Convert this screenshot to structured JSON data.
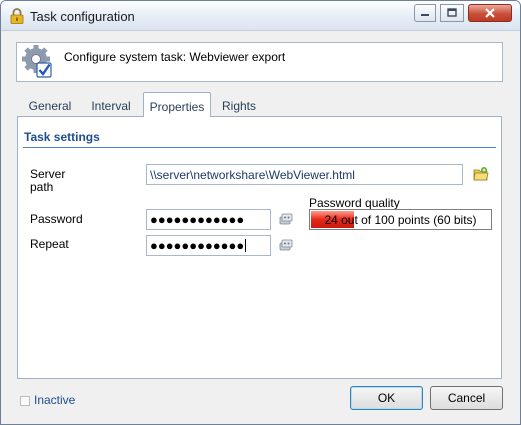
{
  "window": {
    "title": "Task configuration"
  },
  "header": {
    "text": "Configure system task: Webviewer export"
  },
  "tabs": [
    {
      "label": "General"
    },
    {
      "label": "Interval"
    },
    {
      "label": "Properties",
      "active": true
    },
    {
      "label": "Rights"
    }
  ],
  "section": {
    "title": "Task settings"
  },
  "form": {
    "server_path_label_line1": "Server",
    "server_path_label_line2": "path",
    "server_path_value": "\\\\server\\networkshare\\WebViewer.html",
    "password_label": "Password",
    "password_value": "●●●●●●●●●●●●",
    "repeat_label": "Repeat",
    "repeat_value": "●●●●●●●●●●●●",
    "password_quality_label": "Password quality",
    "password_quality_text": "24 out of 100 points (60 bits)",
    "password_quality_points": 24,
    "password_quality_max": 100
  },
  "footer": {
    "inactive_label": "Inactive",
    "inactive_checked": false,
    "ok_label": "OK",
    "cancel_label": "Cancel"
  },
  "icons": {
    "lock": "lock-icon",
    "gear": "gear-checkmark-icon",
    "browse": "folder-browse-icon",
    "generate": "key-generate-icon"
  },
  "colors": {
    "section_title": "#1f4e8c",
    "quality_bar": "#e8281a",
    "accent_border": "#4a86c8"
  }
}
